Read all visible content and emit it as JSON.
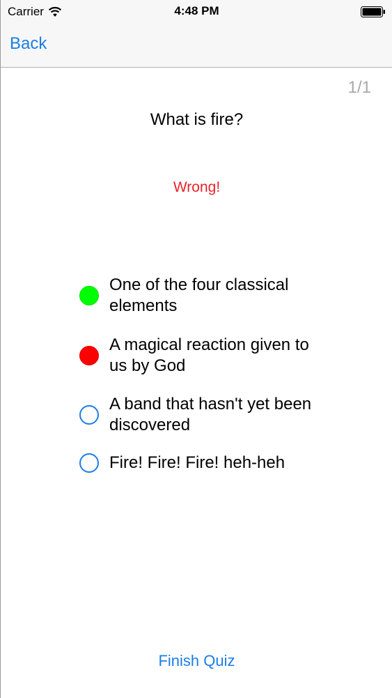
{
  "status_bar": {
    "carrier": "Carrier",
    "time": "4:48 PM"
  },
  "nav": {
    "back_label": "Back"
  },
  "quiz": {
    "counter": "1/1",
    "question": "What is fire?",
    "feedback": "Wrong!",
    "answers": [
      {
        "text": "One of the four classical elements",
        "state": "correct"
      },
      {
        "text": "A magical reaction given to us by God",
        "state": "wrong"
      },
      {
        "text": "A band that hasn't yet been discovered",
        "state": "unselected"
      },
      {
        "text": "Fire! Fire! Fire! heh-heh",
        "state": "unselected"
      }
    ],
    "finish_label": "Finish Quiz"
  },
  "colors": {
    "accent": "#1a7ee6",
    "correct": "#00ff00",
    "wrong": "#ff0000",
    "feedback": "#e8232a"
  }
}
